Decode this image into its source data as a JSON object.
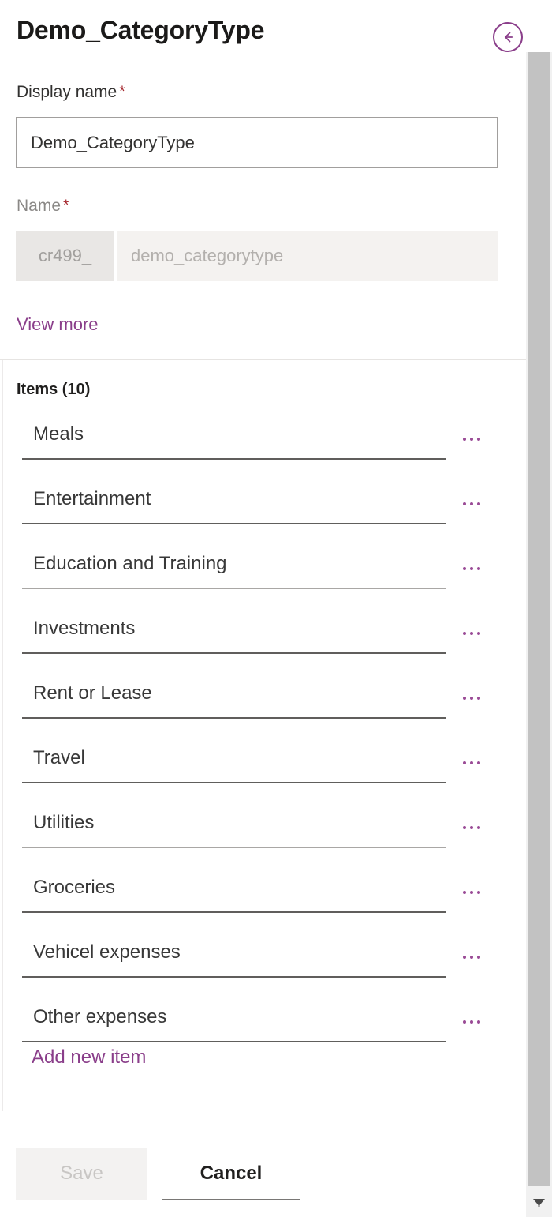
{
  "header": {
    "title": "Demo_CategoryType",
    "back_icon": "circled-back-arrow-icon"
  },
  "display_name_field": {
    "label": "Display name",
    "required_marker": "*",
    "value": "Demo_CategoryType",
    "placeholder": "Display name"
  },
  "name_field": {
    "label": "Name",
    "required_marker": "*",
    "prefix": "cr499_",
    "value": "demo_categorytype",
    "placeholder": "demo_categorytype",
    "disabled": true
  },
  "view_more_link": "View more",
  "items_section": {
    "heading": "Items (10)",
    "items": [
      {
        "value": "Meals",
        "menu_icon": "more-options-icon"
      },
      {
        "value": "Entertainment",
        "menu_icon": "more-options-icon"
      },
      {
        "value": "Education and Training",
        "menu_icon": "more-options-icon"
      },
      {
        "value": "Investments",
        "menu_icon": "more-options-icon"
      },
      {
        "value": "Rent or Lease",
        "menu_icon": "more-options-icon"
      },
      {
        "value": "Travel",
        "menu_icon": "more-options-icon"
      },
      {
        "value": "Utilities",
        "menu_icon": "more-options-icon"
      },
      {
        "value": "Groceries",
        "menu_icon": "more-options-icon"
      },
      {
        "value": "Vehicel expenses",
        "menu_icon": "more-options-icon"
      },
      {
        "value": "Other expenses",
        "menu_icon": "more-options-icon"
      }
    ],
    "add_new_item_label": "Add new item"
  },
  "footer": {
    "save_label": "Save",
    "save_disabled": true,
    "cancel_label": "Cancel"
  },
  "scrollbar": {
    "down_arrow_icon": "chevron-down-icon"
  },
  "colors": {
    "accent_purple": "#8a3e8a",
    "required_red": "#a4262c",
    "disabled_text": "#c8c6c4",
    "scroll_thumb": "#c2c2c2"
  }
}
